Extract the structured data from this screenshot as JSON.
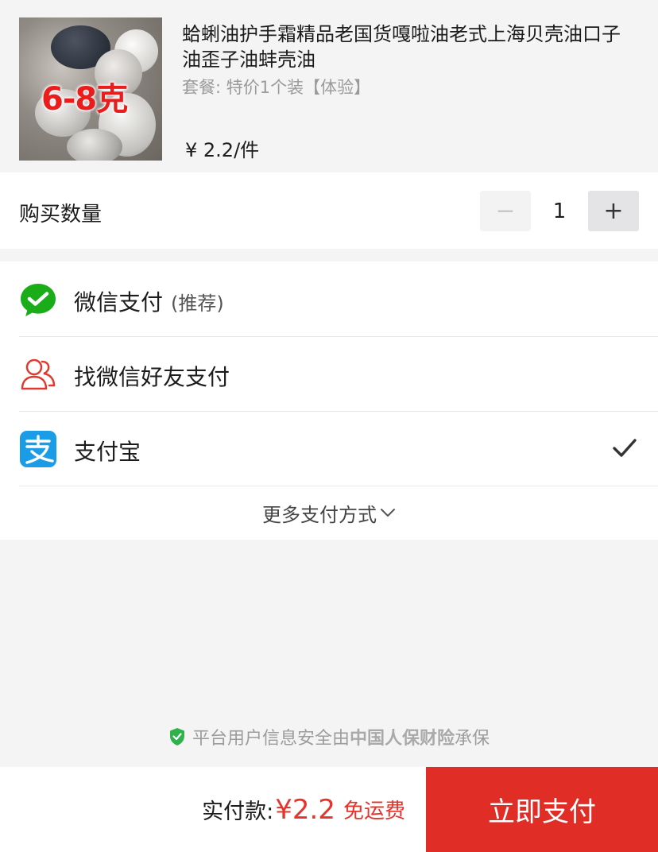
{
  "product": {
    "thumbnail_text": "6-8克",
    "title": "蛤蜊油护手霜精品老国货嘎啦油老式上海贝壳油口子油歪子油蚌壳油",
    "spec": "套餐: 特价1个装【体验】",
    "price": "¥ 2.2/件"
  },
  "quantity": {
    "label": "购买数量",
    "minus": "−",
    "value": "1",
    "plus": "+"
  },
  "payment": {
    "methods": [
      {
        "label": "微信支付",
        "hint": "(推荐)",
        "icon": "wechat-pay-icon",
        "selected": false
      },
      {
        "label": "找微信好友支付",
        "hint": "",
        "icon": "friends-icon",
        "selected": false
      },
      {
        "label": "支付宝",
        "hint": "",
        "icon": "alipay-icon",
        "selected": true
      }
    ],
    "more_label": "更多支付方式"
  },
  "security": {
    "prefix": "平台用户信息安全由",
    "insurer": "中国人保财险",
    "suffix": "承保"
  },
  "checkout": {
    "total_label": "实付款:",
    "total_amount": "¥2.2",
    "shipping": "免运费",
    "pay_button": "立即支付"
  },
  "colors": {
    "accent": "#e02d26",
    "wechat_green": "#1aad19",
    "alipay_blue": "#1b9ce6"
  }
}
